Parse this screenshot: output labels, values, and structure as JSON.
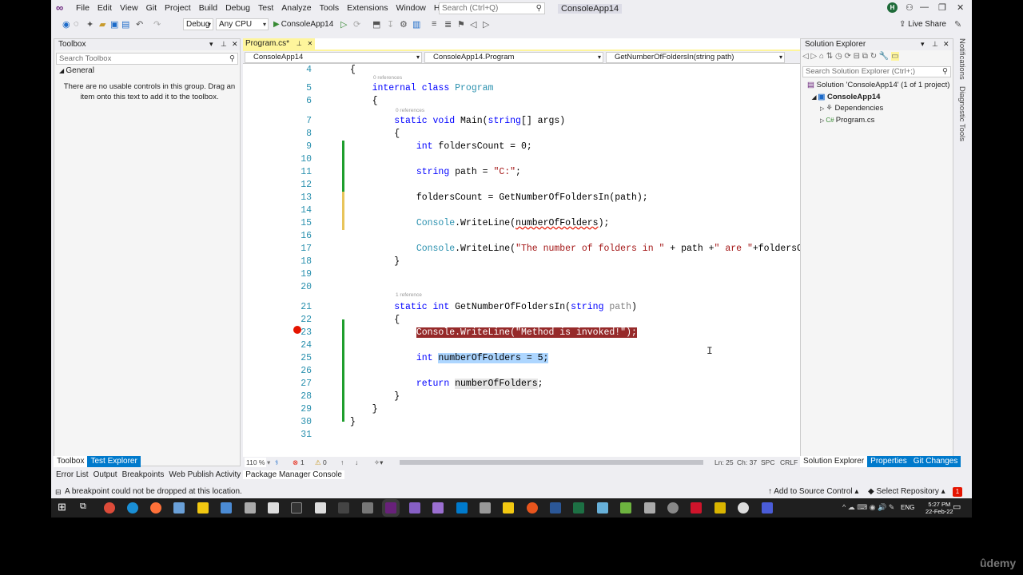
{
  "menubar": {
    "items": [
      "File",
      "Edit",
      "View",
      "Git",
      "Project",
      "Build",
      "Debug",
      "Test",
      "Analyze",
      "Tools",
      "Extensions",
      "Window",
      "Help"
    ],
    "search_placeholder": "Search (Ctrl+Q)",
    "app_title": "ConsoleApp14",
    "avatar_initial": "H"
  },
  "toolbar": {
    "config": "Debug",
    "platform": "Any CPU",
    "run_target": "ConsoleApp14",
    "live_share": "Live Share"
  },
  "toolbox": {
    "title": "Toolbox",
    "search_placeholder": "Search Toolbox",
    "group": "General",
    "message": "There are no usable controls in this group. Drag an item onto this text to add it to the toolbox.",
    "tabs": [
      "Toolbox",
      "Test Explorer"
    ]
  },
  "editor": {
    "tab_label": "Program.cs*",
    "nav_project": "ConsoleApp14",
    "nav_class": "ConsoleApp14.Program",
    "nav_member": "GetNumberOfFoldersIn(string path)",
    "lines": [
      {
        "n": "4",
        "text": "{"
      },
      {
        "n": "5",
        "text": "    internal class Program"
      },
      {
        "n": "6",
        "text": "    {"
      },
      {
        "n": "7",
        "text": "        static void Main(string[] args)"
      },
      {
        "n": "8",
        "text": "        {"
      },
      {
        "n": "9",
        "text": "            int foldersCount = 0;"
      },
      {
        "n": "10",
        "text": ""
      },
      {
        "n": "11",
        "text": "            string path = \"C:\";"
      },
      {
        "n": "12",
        "text": ""
      },
      {
        "n": "13",
        "text": "            foldersCount = GetNumberOfFoldersIn(path);"
      },
      {
        "n": "14",
        "text": ""
      },
      {
        "n": "15",
        "text": "            Console.WriteLine(numberOfFolders);"
      },
      {
        "n": "16",
        "text": ""
      },
      {
        "n": "17",
        "text": "            Console.WriteLine(\"The number of folders in \" + path +\" are \"+foldersCount);"
      },
      {
        "n": "18",
        "text": "        }"
      },
      {
        "n": "19",
        "text": ""
      },
      {
        "n": "20",
        "text": ""
      },
      {
        "n": "21",
        "text": "        static int GetNumberOfFoldersIn(string path)"
      },
      {
        "n": "22",
        "text": "        {"
      },
      {
        "n": "23",
        "text": "            Console.WriteLine(\"Method is invoked!\");"
      },
      {
        "n": "24",
        "text": ""
      },
      {
        "n": "25",
        "text": "            int numberOfFolders = 5;"
      },
      {
        "n": "26",
        "text": ""
      },
      {
        "n": "27",
        "text": "            return numberOfFolders;"
      },
      {
        "n": "28",
        "text": "        }"
      },
      {
        "n": "29",
        "text": "    }"
      },
      {
        "n": "30",
        "text": "}"
      },
      {
        "n": "31",
        "text": ""
      }
    ],
    "codelens": {
      "zero_refs": "0 references",
      "one_ref": "1 reference"
    },
    "zoom": "110 %",
    "errors": "1",
    "warnings": "0",
    "ln": "Ln: 25",
    "ch": "Ch: 37",
    "spc": "SPC",
    "crlf": "CRLF"
  },
  "solution_explorer": {
    "title": "Solution Explorer",
    "search_placeholder": "Search Solution Explorer (Ctrl+;)",
    "solution": "Solution 'ConsoleApp14' (1 of 1 project)",
    "project": "ConsoleApp14",
    "dependencies": "Dependencies",
    "file": "Program.cs",
    "tabs": [
      "Solution Explorer",
      "Properties",
      "Git Changes"
    ],
    "side_tabs": [
      "Notifications",
      "Diagnostic Tools"
    ]
  },
  "tool_tabs": [
    "Error List",
    "Output",
    "Breakpoints",
    "Web Publish Activity",
    "Package Manager Console"
  ],
  "statusbar": {
    "message": "A breakpoint could not be dropped at this location.",
    "source_control": "Add to Source Control",
    "repository": "Select Repository",
    "notifications": "1"
  },
  "taskbar": {
    "lang": "ENG",
    "time": "5:27 PM",
    "date": "22-Feb-22"
  },
  "watermark": "ûdemy"
}
